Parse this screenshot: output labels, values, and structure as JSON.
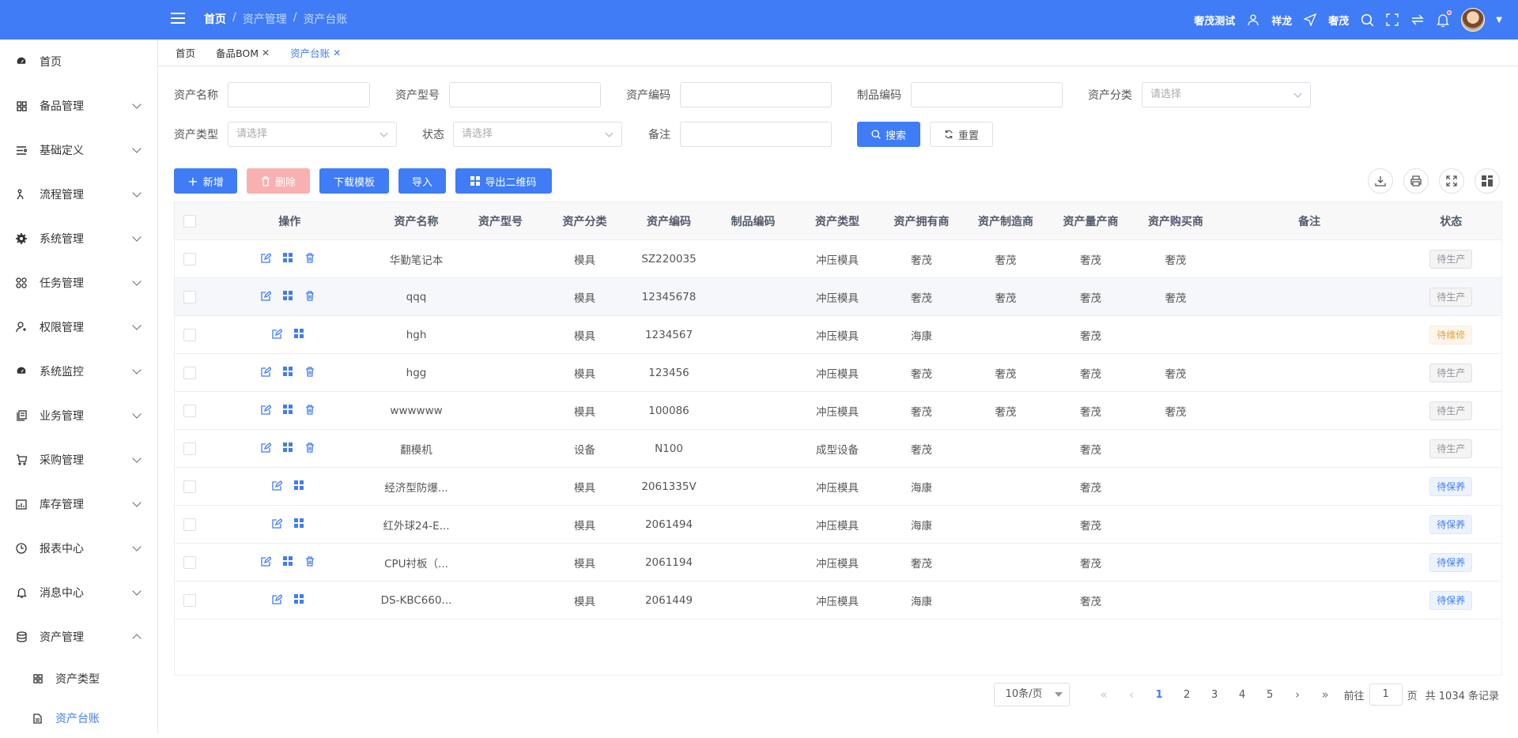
{
  "header": {
    "breadcrumb": [
      "首页",
      "资产管理",
      "资产台账"
    ],
    "separator": "/",
    "user_company": "奢茂测试",
    "user_name": "祥龙",
    "location": "奢茂",
    "accent_color": "#3f7cf6"
  },
  "sidebar": {
    "items": [
      {
        "label": "首页",
        "icon": "dashboard-icon"
      },
      {
        "label": "备品管理",
        "icon": "grid-icon"
      },
      {
        "label": "基础定义",
        "icon": "list-icon"
      },
      {
        "label": "流程管理",
        "icon": "flow-icon"
      },
      {
        "label": "系统管理",
        "icon": "gear-icon"
      },
      {
        "label": "任务管理",
        "icon": "apps-icon"
      },
      {
        "label": "权限管理",
        "icon": "user-key-icon"
      },
      {
        "label": "系统监控",
        "icon": "monitor-icon"
      },
      {
        "label": "业务管理",
        "icon": "documents-icon"
      },
      {
        "label": "采购管理",
        "icon": "cart-icon"
      },
      {
        "label": "库存管理",
        "icon": "bar-chart-icon"
      },
      {
        "label": "报表中心",
        "icon": "clock-icon"
      },
      {
        "label": "消息中心",
        "icon": "bell-icon"
      },
      {
        "label": "资产管理",
        "icon": "database-icon"
      }
    ],
    "subitems": [
      {
        "label": "资产类型",
        "icon": "grid-icon"
      },
      {
        "label": "资产台账",
        "icon": "file-icon"
      }
    ]
  },
  "tabs": [
    {
      "label": "首页"
    },
    {
      "label": "备品BOM"
    },
    {
      "label": "资产台账"
    }
  ],
  "search": {
    "asset_name_label": "资产名称",
    "asset_model_label": "资产型号",
    "asset_code_label": "资产编码",
    "product_code_label": "制品编码",
    "asset_category_label": "资产分类",
    "asset_type_label": "资产类型",
    "status_label": "状态",
    "remark_label": "备注",
    "select_placeholder": "请选择",
    "search_button": "搜索",
    "reset_button": "重置"
  },
  "toolbar": {
    "add": "新增",
    "delete": "删除",
    "download_template": "下载模板",
    "import": "导入",
    "export_qr": "导出二维码"
  },
  "table": {
    "columns": [
      "操作",
      "资产名称",
      "资产型号",
      "资产分类",
      "资产编码",
      "制品编码",
      "资产类型",
      "资产拥有商",
      "资产制造商",
      "资产量产商",
      "资产购买商",
      "备注",
      "状态"
    ],
    "rows": [
      {
        "name": "华勤笔记本",
        "model": "",
        "category": "模具",
        "code": "SZ220035",
        "product_code": "",
        "type": "冲压模具",
        "owner": "奢茂",
        "manufacturer": "奢茂",
        "mass_producer": "奢茂",
        "buyer": "奢茂",
        "remark": "",
        "status": "待生产",
        "status_style": "default",
        "delete": true
      },
      {
        "name": "qqq",
        "model": "",
        "category": "模具",
        "code": "12345678",
        "product_code": "",
        "type": "冲压模具",
        "owner": "奢茂",
        "manufacturer": "奢茂",
        "mass_producer": "奢茂",
        "buyer": "奢茂",
        "remark": "",
        "status": "待生产",
        "status_style": "default",
        "delete": true
      },
      {
        "name": "hgh",
        "model": "",
        "category": "模具",
        "code": "1234567",
        "product_code": "",
        "type": "冲压模具",
        "owner": "海康",
        "manufacturer": "",
        "mass_producer": "奢茂",
        "buyer": "",
        "remark": "",
        "status": "待维修",
        "status_style": "warn",
        "delete": false
      },
      {
        "name": "hgg",
        "model": "",
        "category": "模具",
        "code": "123456",
        "product_code": "",
        "type": "冲压模具",
        "owner": "奢茂",
        "manufacturer": "奢茂",
        "mass_producer": "奢茂",
        "buyer": "奢茂",
        "remark": "",
        "status": "待生产",
        "status_style": "default",
        "delete": true
      },
      {
        "name": "wwwwww",
        "model": "",
        "category": "模具",
        "code": "100086",
        "product_code": "",
        "type": "冲压模具",
        "owner": "奢茂",
        "manufacturer": "奢茂",
        "mass_producer": "奢茂",
        "buyer": "奢茂",
        "remark": "",
        "status": "待生产",
        "status_style": "default",
        "delete": true
      },
      {
        "name": "翻模机",
        "model": "",
        "category": "设备",
        "code": "N100",
        "product_code": "",
        "type": "成型设备",
        "owner": "奢茂",
        "manufacturer": "",
        "mass_producer": "奢茂",
        "buyer": "",
        "remark": "",
        "status": "待生产",
        "status_style": "default",
        "delete": true
      },
      {
        "name": "经济型防爆...",
        "model": "",
        "category": "模具",
        "code": "2061335V",
        "product_code": "",
        "type": "冲压模具",
        "owner": "海康",
        "manufacturer": "",
        "mass_producer": "奢茂",
        "buyer": "",
        "remark": "",
        "status": "待保养",
        "status_style": "info",
        "delete": false
      },
      {
        "name": "红外球24-E...",
        "model": "",
        "category": "模具",
        "code": "2061494",
        "product_code": "",
        "type": "冲压模具",
        "owner": "海康",
        "manufacturer": "",
        "mass_producer": "奢茂",
        "buyer": "",
        "remark": "",
        "status": "待保养",
        "status_style": "info",
        "delete": false
      },
      {
        "name": "CPU衬板（...",
        "model": "",
        "category": "模具",
        "code": "2061194",
        "product_code": "",
        "type": "冲压模具",
        "owner": "奢茂",
        "manufacturer": "",
        "mass_producer": "奢茂",
        "buyer": "",
        "remark": "",
        "status": "待保养",
        "status_style": "info",
        "delete": true
      },
      {
        "name": "DS-KBC660...",
        "model": "",
        "category": "模具",
        "code": "2061449",
        "product_code": "",
        "type": "冲压模具",
        "owner": "海康",
        "manufacturer": "",
        "mass_producer": "奢茂",
        "buyer": "",
        "remark": "",
        "status": "待保养",
        "status_style": "info",
        "delete": false
      }
    ]
  },
  "pagination": {
    "page_size": "10条/页",
    "pages": [
      "1",
      "2",
      "3",
      "4",
      "5"
    ],
    "current": "1",
    "goto_label": "前往",
    "goto_value": "1",
    "page_unit": "页",
    "total": "共 1034 条记录"
  }
}
